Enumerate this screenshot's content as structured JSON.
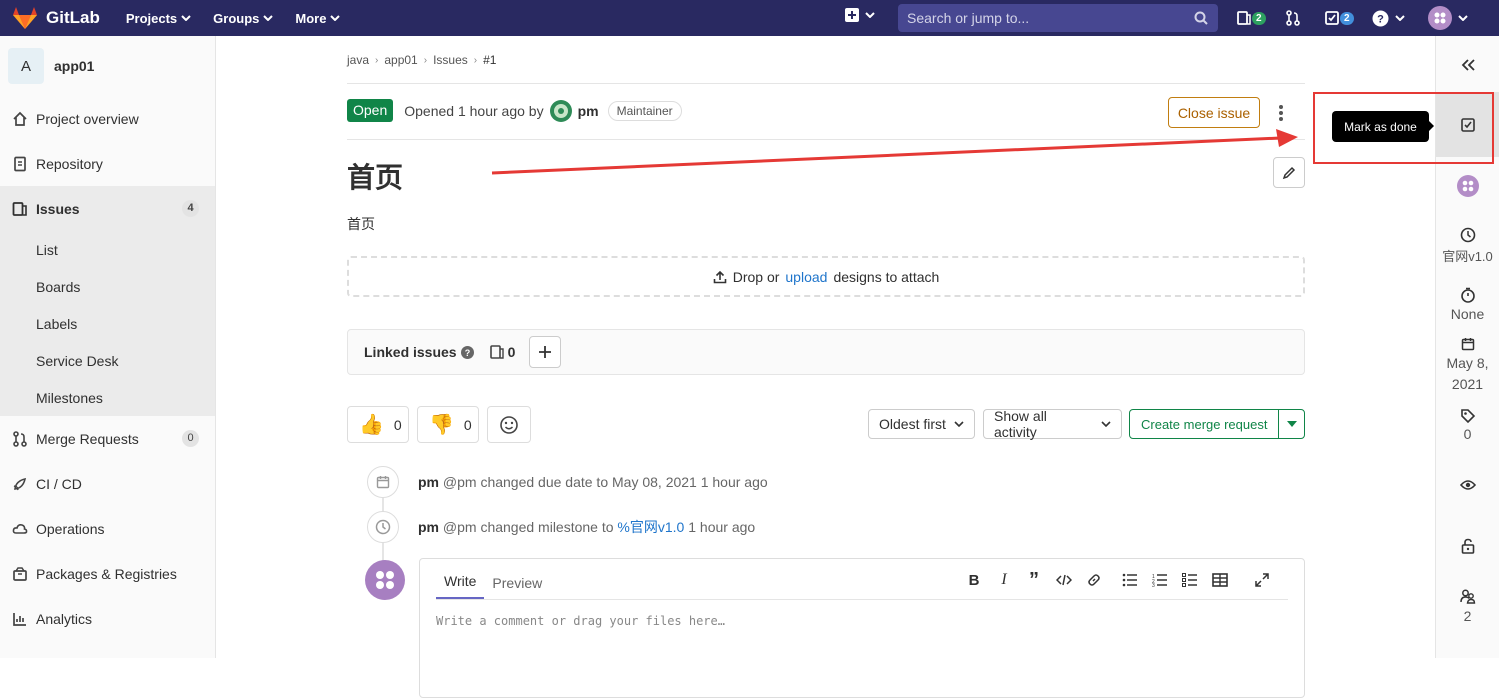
{
  "topbar": {
    "brand": "GitLab",
    "nav": [
      "Projects",
      "Groups",
      "More"
    ],
    "search_placeholder": "Search or jump to...",
    "issues_count": "2",
    "todos_count": "2",
    "colors": {
      "bg": "#292961",
      "search_bg": "#474791"
    }
  },
  "sidebar": {
    "project_initial": "A",
    "project_name": "app01",
    "items": [
      {
        "label": "Project overview",
        "icon": "home-icon"
      },
      {
        "label": "Repository",
        "icon": "doc-icon"
      },
      {
        "label": "Issues",
        "icon": "issues-icon",
        "count": "4"
      },
      {
        "label": "Merge Requests",
        "icon": "merge-icon",
        "count": "0"
      },
      {
        "label": "CI / CD",
        "icon": "rocket-icon"
      },
      {
        "label": "Operations",
        "icon": "cloud-icon"
      },
      {
        "label": "Packages & Registries",
        "icon": "package-icon"
      },
      {
        "label": "Analytics",
        "icon": "chart-icon"
      }
    ],
    "sub_items": [
      "List",
      "Boards",
      "Labels",
      "Service Desk",
      "Milestones"
    ]
  },
  "breadcrumb": [
    "java",
    "app01",
    "Issues",
    "#1"
  ],
  "issue": {
    "status": "Open",
    "opened_text": "Opened 1 hour ago by",
    "author": "pm",
    "role": "Maintainer",
    "close_label": "Close issue",
    "title": "首页",
    "description": "首页",
    "drop_prefix": "Drop or",
    "drop_link": "upload",
    "drop_suffix": "designs to attach",
    "linked_title": "Linked issues",
    "linked_count": "0",
    "thumbs_up": "0",
    "thumbs_down": "0",
    "sort_label": "Oldest first",
    "filter_label": "Show all activity",
    "mr_label": "Create merge request"
  },
  "timeline": [
    {
      "user": "pm",
      "text": "@pm changed due date to May 08, 2021 1 hour ago",
      "icon": "calendar-icon"
    },
    {
      "user": "pm",
      "prefix": "@pm changed milestone to",
      "link": "%官网v1.0",
      "suffix": "1 hour ago",
      "icon": "clock-icon"
    }
  ],
  "editor": {
    "tab_write": "Write",
    "tab_preview": "Preview",
    "placeholder": "Write a comment or drag your files here…"
  },
  "right_sidebar": {
    "tooltip": "Mark as done",
    "milestone": "官网v1.0",
    "time_tracking": "None",
    "due_date_line1": "May 8,",
    "due_date_line2": "2021",
    "labels_count": "0",
    "participants_count": "2"
  }
}
